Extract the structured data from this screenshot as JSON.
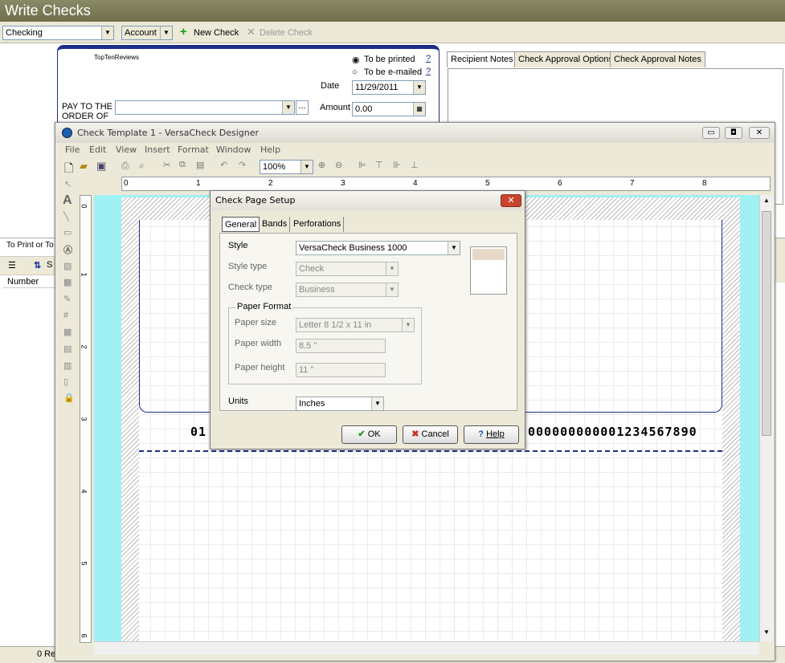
{
  "app": {
    "title": "Write Checks"
  },
  "toolbar": {
    "account_select": "Checking",
    "account_menu": "Account",
    "new_check": "New Check",
    "delete_check": "Delete Check"
  },
  "check": {
    "payee_name": "TopTenReviews",
    "to_be_printed": "To be printed",
    "to_be_emailed": "To be e-mailed",
    "help_mark": "?",
    "date_label": "Date",
    "date_value": "11/29/2011",
    "pay_to_label_1": "PAY TO THE",
    "pay_to_label_2": "ORDER OF",
    "amount_label": "Amount",
    "amount_value": "0.00",
    "browse": "..."
  },
  "right_tabs": [
    {
      "label": "Recipient Notes"
    },
    {
      "label": "Check Approval Options"
    },
    {
      "label": "Check Approval Notes"
    }
  ],
  "left_panel": {
    "to_print_label": "To Print or To",
    "sort_label": "S",
    "number_col": "Number",
    "status_count": "0 Re"
  },
  "designer": {
    "title": "Check Template 1 - VersaCheck Designer",
    "menu": [
      "File",
      "Edit",
      "View",
      "Insert",
      "Format",
      "Window",
      "Help"
    ],
    "zoom": "100%",
    "ruler_h": [
      "0",
      "1",
      "2",
      "3",
      "4",
      "5",
      "6",
      "7",
      "8"
    ],
    "ruler_v": [
      "0",
      "1",
      "2",
      "3",
      "4",
      "5",
      "6"
    ],
    "micr_left": "01",
    "micr_right": "000000000001234567890"
  },
  "dialog": {
    "title": "Check Page Setup",
    "close": "✕",
    "tabs": [
      {
        "label": "General"
      },
      {
        "label": "Bands"
      },
      {
        "label": "Perforations"
      }
    ],
    "style_label": "Style",
    "style_value": "VersaCheck Business 1000",
    "style_type_label": "Style type",
    "style_type_value": "Check",
    "check_type_label": "Check type",
    "check_type_value": "Business",
    "paper_format_label": "Paper Format",
    "paper_size_label": "Paper size",
    "paper_size_value": "Letter 8 1/2 x 11 in",
    "paper_width_label": "Paper width",
    "paper_width_value": "8.5 \"",
    "paper_height_label": "Paper height",
    "paper_height_value": "11 \"",
    "units_label": "Units",
    "units_value": "Inches",
    "ok": "OK",
    "cancel": "Cancel",
    "help": "Help"
  }
}
